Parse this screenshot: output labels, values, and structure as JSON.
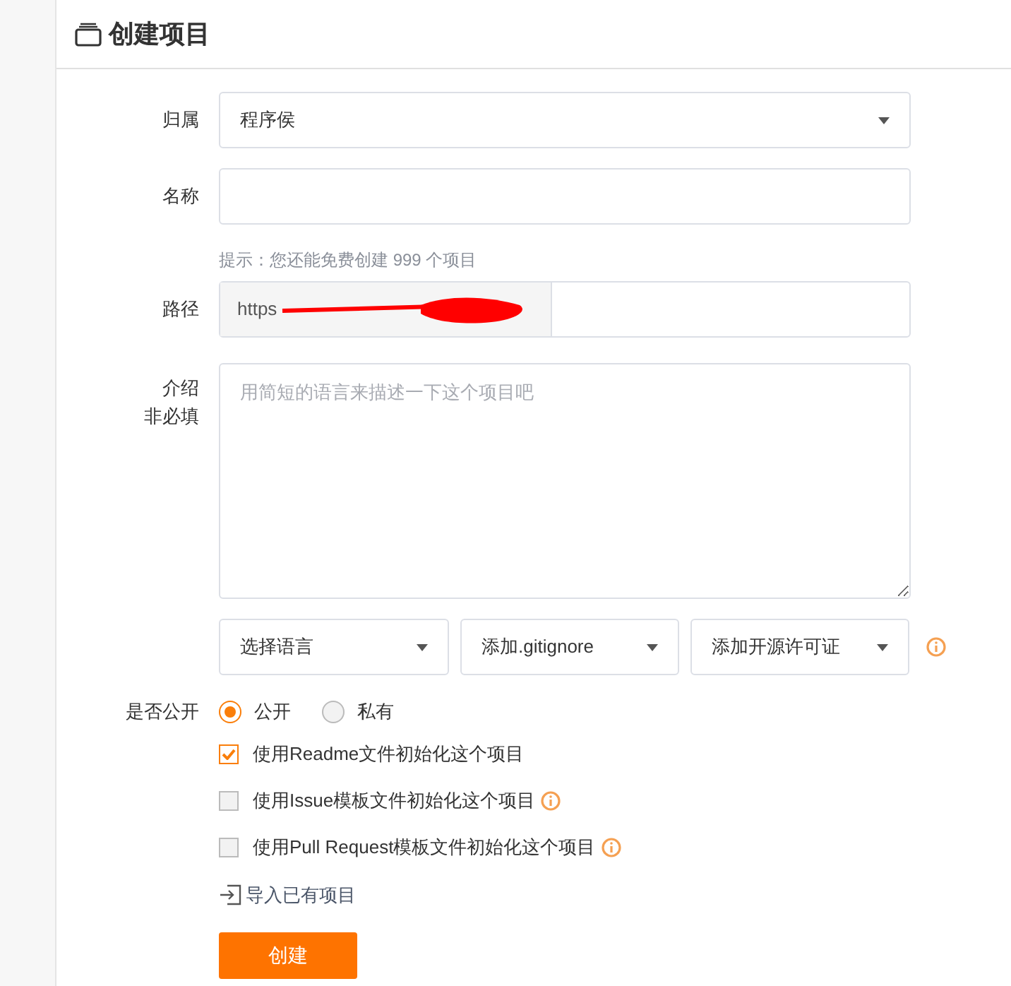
{
  "title": "创建项目",
  "owner": {
    "label": "归属",
    "value": "程序侯"
  },
  "name": {
    "label": "名称",
    "hint": "提示：您还能免费创建 999 个项目"
  },
  "path": {
    "label": "路径",
    "prefix": "https"
  },
  "intro": {
    "label": "介绍",
    "sublabel": "非必填",
    "placeholder": "用简短的语言来描述一下这个项目吧"
  },
  "selects": [
    {
      "value": "选择语言",
      "info": false
    },
    {
      "value": "添加.gitignore",
      "info": false
    },
    {
      "value": "添加开源许可证",
      "info": true
    }
  ],
  "visibility": {
    "label": "是否公开",
    "options": [
      {
        "label": "公开",
        "selected": true
      },
      {
        "label": "私有",
        "selected": false
      }
    ]
  },
  "checkboxes": [
    {
      "label": "使用Readme文件初始化这个项目",
      "checked": true,
      "info": false
    },
    {
      "label": "使用Issue模板文件初始化这个项目",
      "checked": false,
      "info": true
    },
    {
      "label": "使用Pull Request模板文件初始化这个项目",
      "checked": false,
      "info": true
    }
  ],
  "import_link": "导入已有项目",
  "submit": "创建"
}
